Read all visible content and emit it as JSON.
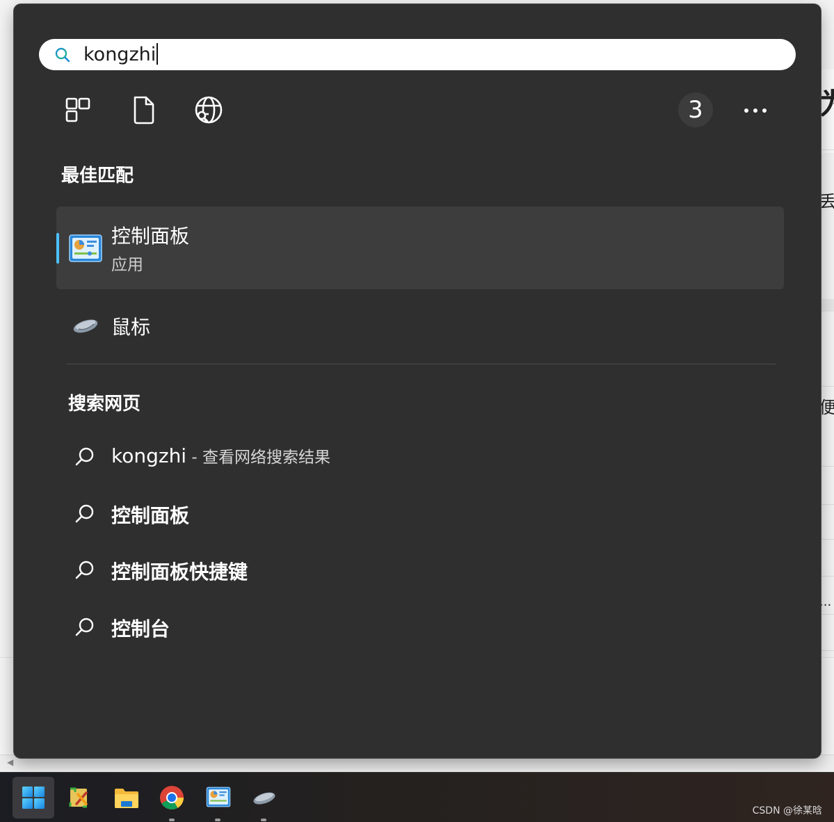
{
  "search": {
    "query": "kongzhi",
    "result_count": "3",
    "filters": [
      "apps-icon",
      "documents-icon",
      "web-icon"
    ]
  },
  "best_match": {
    "heading": "最佳匹配",
    "app_name": "控制面板",
    "app_type": "应用"
  },
  "other_results": [
    {
      "label": "鼠标",
      "icon": "mouse-icon"
    }
  ],
  "web_search": {
    "heading": "搜索网页",
    "items": [
      {
        "query": "kongzhi",
        "suffix": " - 查看网络搜索结果"
      },
      {
        "query": "控制面板"
      },
      {
        "query": "控制面板快捷键"
      },
      {
        "query": "控制台"
      }
    ]
  },
  "background": {
    "glyphs": [
      "为",
      "丢",
      "便",
      "..."
    ]
  },
  "taskbar": {
    "apps": [
      "start-icon",
      "tools-icon",
      "file-explorer-icon",
      "chrome-icon",
      "control-panel-icon",
      "mouse-icon"
    ]
  },
  "watermark": "CSDN @徐某晗",
  "colors": {
    "panel": "#2f2f2f",
    "selected_row": "#3d3d3d",
    "accent": "#4cc2ff"
  }
}
